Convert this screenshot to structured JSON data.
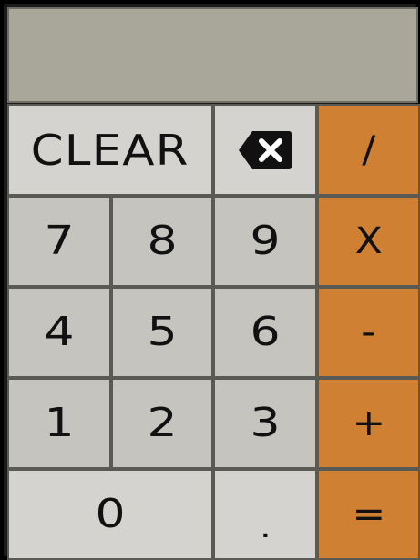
{
  "display": {
    "value": ""
  },
  "keys": {
    "clear": "CLEAR",
    "backspace_icon": "backspace-icon",
    "divide": "/",
    "seven": "7",
    "eight": "8",
    "nine": "9",
    "multiply": "X",
    "four": "4",
    "five": "5",
    "six": "6",
    "subtract": "-",
    "one": "1",
    "two": "2",
    "three": "3",
    "add": "+",
    "zero": "0",
    "decimal": ".",
    "equals": "="
  },
  "colors": {
    "display_bg": "#a8a79a",
    "key_light": "#d4d3cf",
    "key_grey": "#c5c4be",
    "operator": "#cf8033",
    "frame": "#000000"
  }
}
